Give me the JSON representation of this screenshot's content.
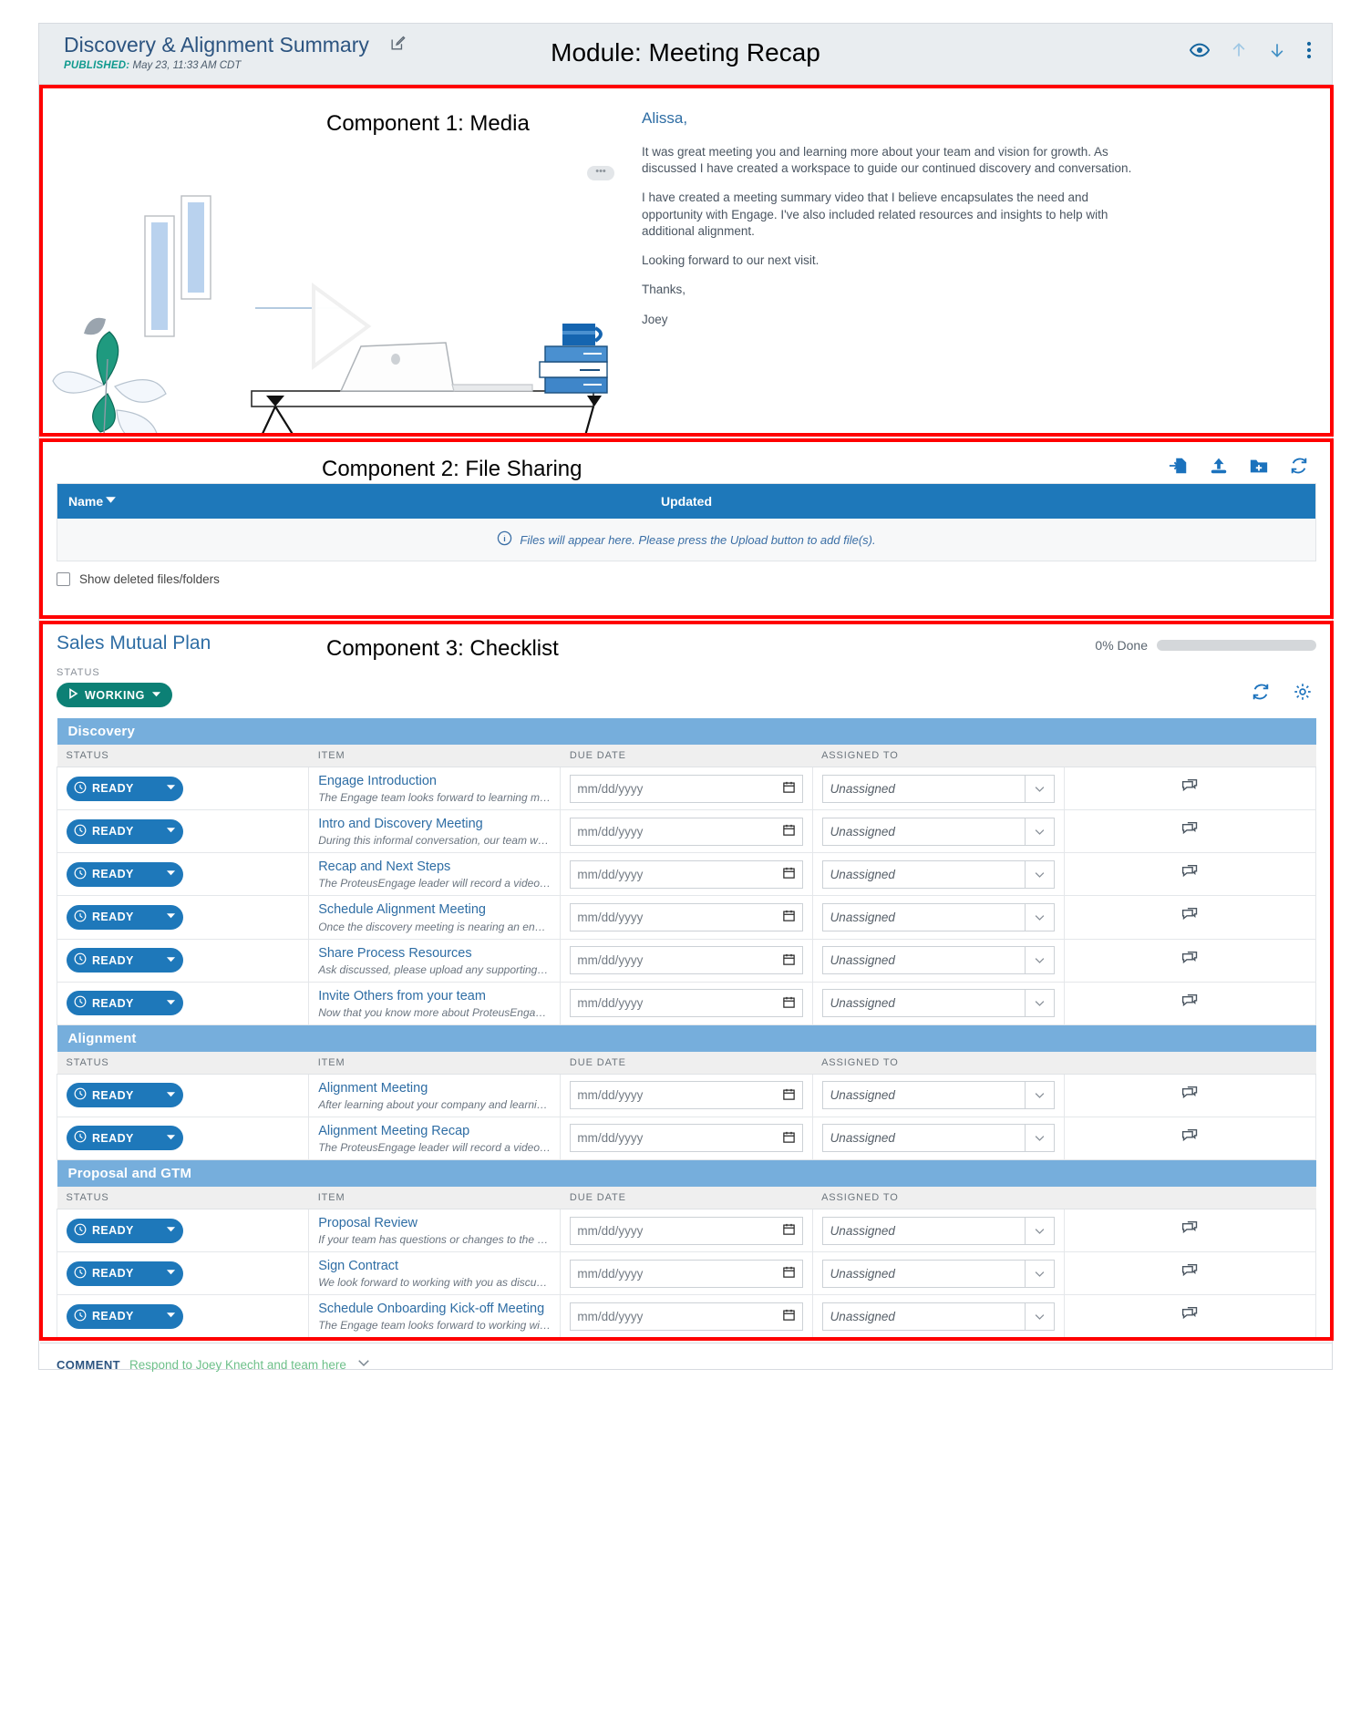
{
  "header": {
    "doc_title": "Discovery & Alignment Summary",
    "published_label": "PUBLISHED:",
    "published_value": "May 23, 11:33 AM CDT",
    "module_title": "Module: Meeting Recap",
    "icons": [
      "preview-eye-icon",
      "move-up-icon",
      "move-down-icon",
      "more-options-icon"
    ]
  },
  "annotations": {
    "component1": "Component 1: Media",
    "component2": "Component 2: File Sharing",
    "component3": "Component 3: Checklist"
  },
  "media": {
    "overflow_dots": "•••",
    "greeting": "Alissa,",
    "paragraphs": [
      "It was great meeting you and learning more about your team and vision for growth. As discussed I have created a workspace to guide our continued discovery and conversation.",
      "I have created a meeting summary video that I believe encapsulates the need and opportunity with Engage. I've also included related resources and insights to help with additional alignment.",
      "Looking forward to our next visit.",
      "Thanks,",
      "Joey"
    ]
  },
  "file_sharing": {
    "toolbar": [
      "import-file-icon",
      "upload-icon",
      "new-folder-icon",
      "refresh-icon"
    ],
    "columns": {
      "name": "Name",
      "updated": "Updated"
    },
    "empty_message": "Files will appear here. Please press the Upload button to add file(s).",
    "show_deleted_label": "Show deleted files/folders"
  },
  "checklist": {
    "title": "Sales Mutual Plan",
    "progress_label": "0% Done",
    "progress_percent": 0,
    "status_caption": "STATUS",
    "status_value": "WORKING",
    "actions": [
      "refresh-icon",
      "settings-gear-icon"
    ],
    "column_headers": {
      "status": "STATUS",
      "item": "ITEM",
      "due_date": "DUE DATE",
      "assigned_to": "ASSIGNED TO"
    },
    "date_placeholder": "mm/dd/yyyy",
    "assignee_value": "Unassigned",
    "row_status_label": "READY",
    "sections": [
      {
        "name": "Discovery",
        "items": [
          {
            "status": "READY",
            "name": "Engage Introduction",
            "description": "The Engage team looks forward to learning more about your company and client onboarding experiences. I look...",
            "due_date": "",
            "assigned_to": "Unassigned"
          },
          {
            "status": "READY",
            "name": "Intro and Discovery Meeting",
            "description": "During this informal conversation, our team will learn more about you and your goals. We will discuss your...",
            "due_date": "",
            "assigned_to": "Unassigned"
          },
          {
            "status": "READY",
            "name": "Recap and Next Steps",
            "description": "The ProteusEngage leader will record a video with highlights from the discovery meeting as a recap. This video will...",
            "due_date": "",
            "assigned_to": "Unassigned"
          },
          {
            "status": "READY",
            "name": "Schedule Alignment Meeting",
            "description": "Once the discovery meeting is nearing an end, the ProteusEngage leader will schedule an alignment meeting at...",
            "due_date": "",
            "assigned_to": "Unassigned"
          },
          {
            "status": "READY",
            "name": "Share Process Resources",
            "description": "Ask discussed, please upload any supporting documentation for your internal processes.",
            "due_date": "",
            "assigned_to": "Unassigned"
          },
          {
            "status": "READY",
            "name": "Invite Others from your team",
            "description": "Now that you know more about ProteusEngage and how our product could best fit, we encourage you to invite...",
            "due_date": "",
            "assigned_to": "Unassigned"
          }
        ]
      },
      {
        "name": "Alignment",
        "items": [
          {
            "status": "READY",
            "name": "Alignment Meeting",
            "description": "After learning about your company and learning what use cases of Engage would bring the most value, we have a...",
            "due_date": "",
            "assigned_to": "Unassigned"
          },
          {
            "status": "READY",
            "name": "Alignment Meeting Recap",
            "description": "The ProteusEngage leader will record a video with highlights from the alignment meeting as a recap. This video wi...",
            "due_date": "",
            "assigned_to": "Unassigned"
          }
        ]
      },
      {
        "name": "Proposal and GTM",
        "items": [
          {
            "status": "READY",
            "name": "Proposal Review",
            "description": "If your team has questions or changes to the proposal we presented, we can schedule a call to review those items.",
            "due_date": "",
            "assigned_to": "Unassigned"
          },
          {
            "status": "READY",
            "name": "Sign Contract",
            "description": "We look forward to working with you as discussed please execute the following contract.",
            "due_date": "",
            "assigned_to": "Unassigned"
          },
          {
            "status": "READY",
            "name": "Schedule Onboarding Kick-off Meeting",
            "description": "The Engage team looks forward to working with you and the team. To ensure success and getting started on the...",
            "due_date": "",
            "assigned_to": "Unassigned"
          }
        ]
      }
    ]
  },
  "comment_bar": {
    "key": "COMMENT",
    "placeholder": "Respond to Joey Knecht and team here"
  },
  "colors": {
    "brand_blue": "#1e78ba",
    "title_blue": "#2e6da4",
    "section_band": "#76aedc",
    "status_teal": "#0c8075",
    "annotation_red": "#ff0000",
    "published_teal": "#0f9a8e"
  }
}
